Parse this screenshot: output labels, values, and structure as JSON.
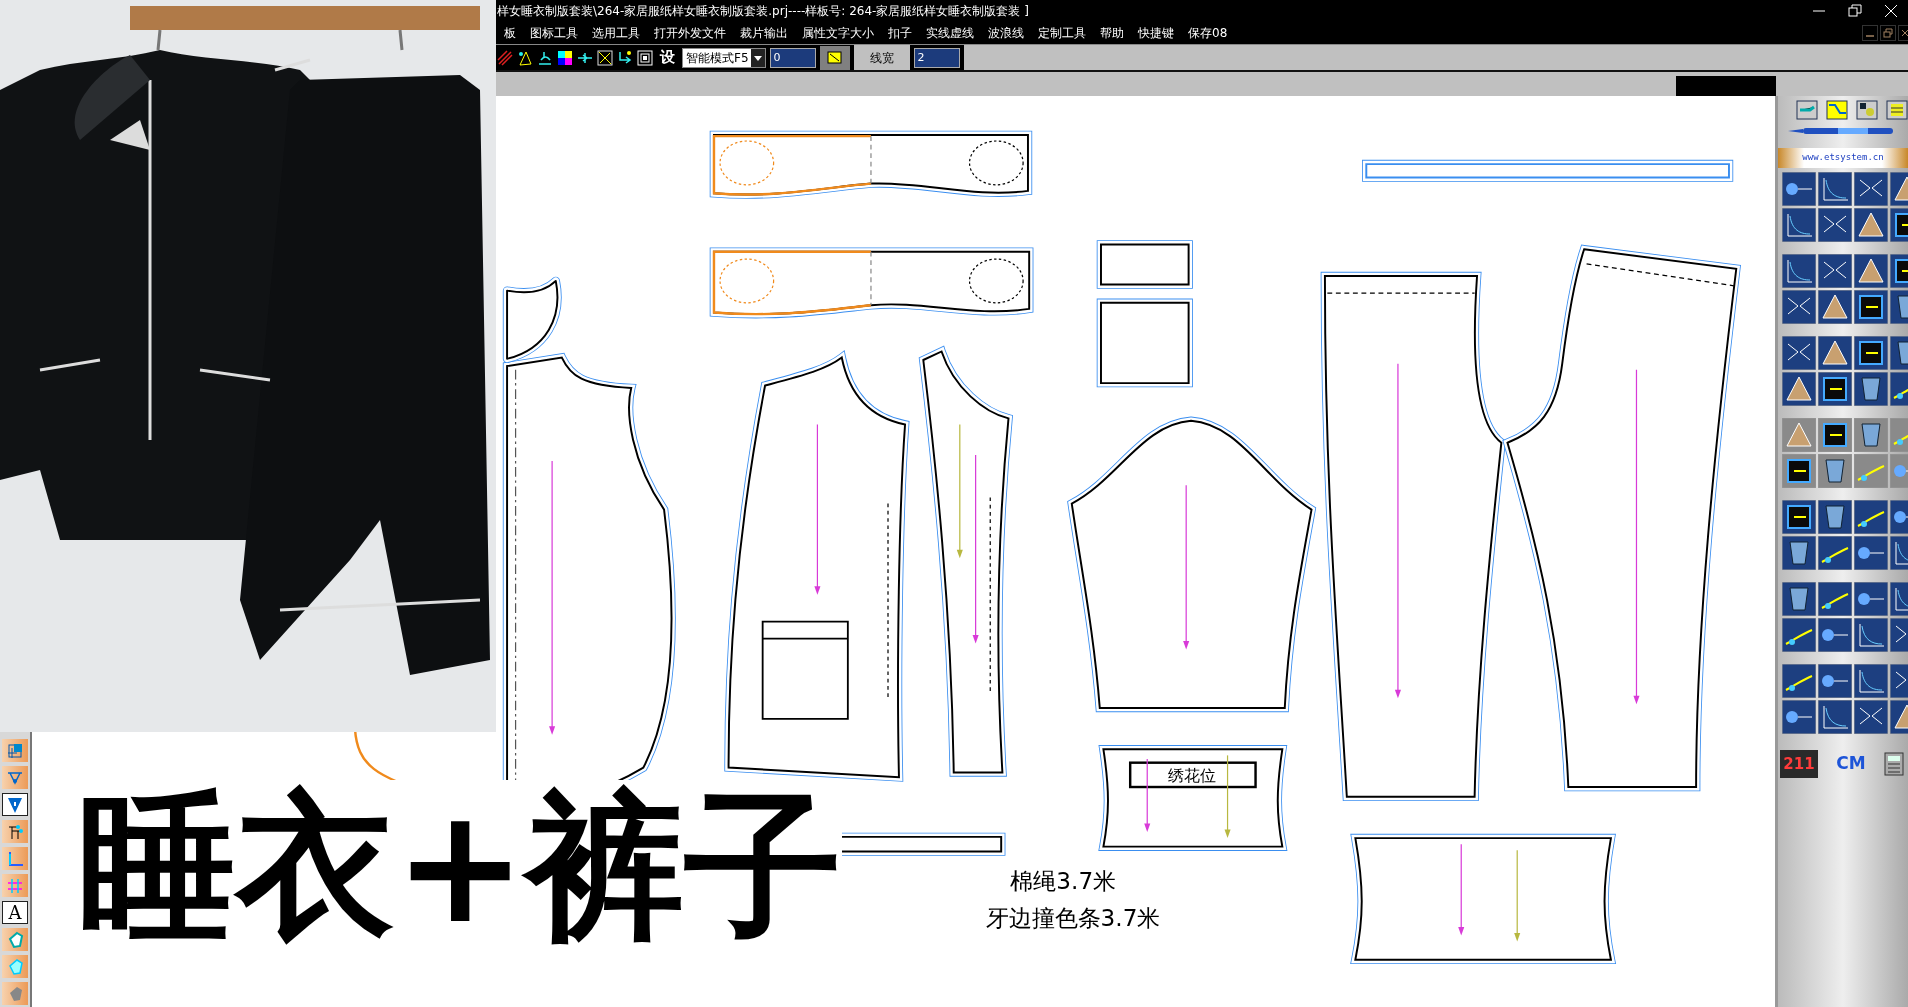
{
  "window": {
    "title": "样女睡衣制版套装\\264-家居服纸样女睡衣制版套装.prj----样板号:  264-家居服纸样女睡衣制版套装 ]"
  },
  "menu": [
    {
      "label": "板"
    },
    {
      "label": "图标工具"
    },
    {
      "label": "选用工具"
    },
    {
      "label": "打开外发文件"
    },
    {
      "label": "裁片输出"
    },
    {
      "label": "属性文字大小"
    },
    {
      "label": "扣子"
    },
    {
      "label": "实线虚线"
    },
    {
      "label": "波浪线"
    },
    {
      "label": "定制工具"
    },
    {
      "label": "帮助"
    },
    {
      "label": "快捷键"
    },
    {
      "label": "保存08"
    }
  ],
  "toolbar": {
    "set_button": "设",
    "mode_select": "智能模式F5",
    "value_field": "0",
    "line_width_label": "线宽",
    "line_width_field": "2"
  },
  "left_toolbar": {
    "text_tool": "A"
  },
  "canvas": {
    "embroidery_label": "绣花位",
    "notes": [
      "棉绳3.7米",
      "牙边撞色条3.7米"
    ]
  },
  "right_panel": {
    "website": "www.etsystem.cn",
    "count": "211",
    "unit": "CM"
  },
  "caption": "睡衣+裤子"
}
